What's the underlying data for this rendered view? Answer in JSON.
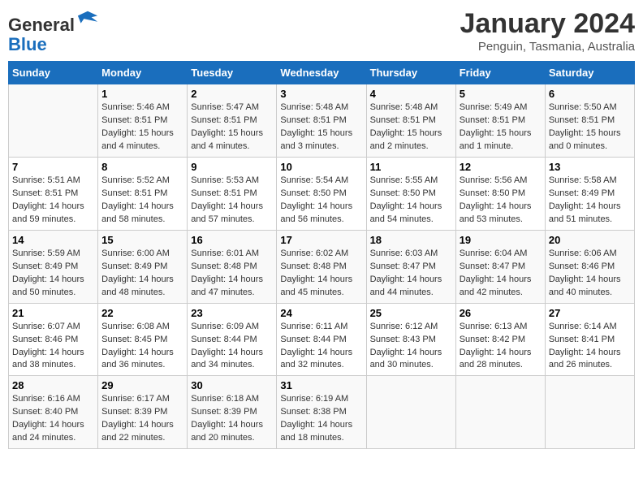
{
  "header": {
    "logo_general": "General",
    "logo_blue": "Blue",
    "title": "January 2024",
    "subtitle": "Penguin, Tasmania, Australia"
  },
  "days_of_week": [
    "Sunday",
    "Monday",
    "Tuesday",
    "Wednesday",
    "Thursday",
    "Friday",
    "Saturday"
  ],
  "weeks": [
    [
      {
        "date": "",
        "info": ""
      },
      {
        "date": "1",
        "info": "Sunrise: 5:46 AM\nSunset: 8:51 PM\nDaylight: 15 hours\nand 4 minutes."
      },
      {
        "date": "2",
        "info": "Sunrise: 5:47 AM\nSunset: 8:51 PM\nDaylight: 15 hours\nand 4 minutes."
      },
      {
        "date": "3",
        "info": "Sunrise: 5:48 AM\nSunset: 8:51 PM\nDaylight: 15 hours\nand 3 minutes."
      },
      {
        "date": "4",
        "info": "Sunrise: 5:48 AM\nSunset: 8:51 PM\nDaylight: 15 hours\nand 2 minutes."
      },
      {
        "date": "5",
        "info": "Sunrise: 5:49 AM\nSunset: 8:51 PM\nDaylight: 15 hours\nand 1 minute."
      },
      {
        "date": "6",
        "info": "Sunrise: 5:50 AM\nSunset: 8:51 PM\nDaylight: 15 hours\nand 0 minutes."
      }
    ],
    [
      {
        "date": "7",
        "info": "Sunrise: 5:51 AM\nSunset: 8:51 PM\nDaylight: 14 hours\nand 59 minutes."
      },
      {
        "date": "8",
        "info": "Sunrise: 5:52 AM\nSunset: 8:51 PM\nDaylight: 14 hours\nand 58 minutes."
      },
      {
        "date": "9",
        "info": "Sunrise: 5:53 AM\nSunset: 8:51 PM\nDaylight: 14 hours\nand 57 minutes."
      },
      {
        "date": "10",
        "info": "Sunrise: 5:54 AM\nSunset: 8:50 PM\nDaylight: 14 hours\nand 56 minutes."
      },
      {
        "date": "11",
        "info": "Sunrise: 5:55 AM\nSunset: 8:50 PM\nDaylight: 14 hours\nand 54 minutes."
      },
      {
        "date": "12",
        "info": "Sunrise: 5:56 AM\nSunset: 8:50 PM\nDaylight: 14 hours\nand 53 minutes."
      },
      {
        "date": "13",
        "info": "Sunrise: 5:58 AM\nSunset: 8:49 PM\nDaylight: 14 hours\nand 51 minutes."
      }
    ],
    [
      {
        "date": "14",
        "info": "Sunrise: 5:59 AM\nSunset: 8:49 PM\nDaylight: 14 hours\nand 50 minutes."
      },
      {
        "date": "15",
        "info": "Sunrise: 6:00 AM\nSunset: 8:49 PM\nDaylight: 14 hours\nand 48 minutes."
      },
      {
        "date": "16",
        "info": "Sunrise: 6:01 AM\nSunset: 8:48 PM\nDaylight: 14 hours\nand 47 minutes."
      },
      {
        "date": "17",
        "info": "Sunrise: 6:02 AM\nSunset: 8:48 PM\nDaylight: 14 hours\nand 45 minutes."
      },
      {
        "date": "18",
        "info": "Sunrise: 6:03 AM\nSunset: 8:47 PM\nDaylight: 14 hours\nand 44 minutes."
      },
      {
        "date": "19",
        "info": "Sunrise: 6:04 AM\nSunset: 8:47 PM\nDaylight: 14 hours\nand 42 minutes."
      },
      {
        "date": "20",
        "info": "Sunrise: 6:06 AM\nSunset: 8:46 PM\nDaylight: 14 hours\nand 40 minutes."
      }
    ],
    [
      {
        "date": "21",
        "info": "Sunrise: 6:07 AM\nSunset: 8:46 PM\nDaylight: 14 hours\nand 38 minutes."
      },
      {
        "date": "22",
        "info": "Sunrise: 6:08 AM\nSunset: 8:45 PM\nDaylight: 14 hours\nand 36 minutes."
      },
      {
        "date": "23",
        "info": "Sunrise: 6:09 AM\nSunset: 8:44 PM\nDaylight: 14 hours\nand 34 minutes."
      },
      {
        "date": "24",
        "info": "Sunrise: 6:11 AM\nSunset: 8:44 PM\nDaylight: 14 hours\nand 32 minutes."
      },
      {
        "date": "25",
        "info": "Sunrise: 6:12 AM\nSunset: 8:43 PM\nDaylight: 14 hours\nand 30 minutes."
      },
      {
        "date": "26",
        "info": "Sunrise: 6:13 AM\nSunset: 8:42 PM\nDaylight: 14 hours\nand 28 minutes."
      },
      {
        "date": "27",
        "info": "Sunrise: 6:14 AM\nSunset: 8:41 PM\nDaylight: 14 hours\nand 26 minutes."
      }
    ],
    [
      {
        "date": "28",
        "info": "Sunrise: 6:16 AM\nSunset: 8:40 PM\nDaylight: 14 hours\nand 24 minutes."
      },
      {
        "date": "29",
        "info": "Sunrise: 6:17 AM\nSunset: 8:39 PM\nDaylight: 14 hours\nand 22 minutes."
      },
      {
        "date": "30",
        "info": "Sunrise: 6:18 AM\nSunset: 8:39 PM\nDaylight: 14 hours\nand 20 minutes."
      },
      {
        "date": "31",
        "info": "Sunrise: 6:19 AM\nSunset: 8:38 PM\nDaylight: 14 hours\nand 18 minutes."
      },
      {
        "date": "",
        "info": ""
      },
      {
        "date": "",
        "info": ""
      },
      {
        "date": "",
        "info": ""
      }
    ]
  ]
}
